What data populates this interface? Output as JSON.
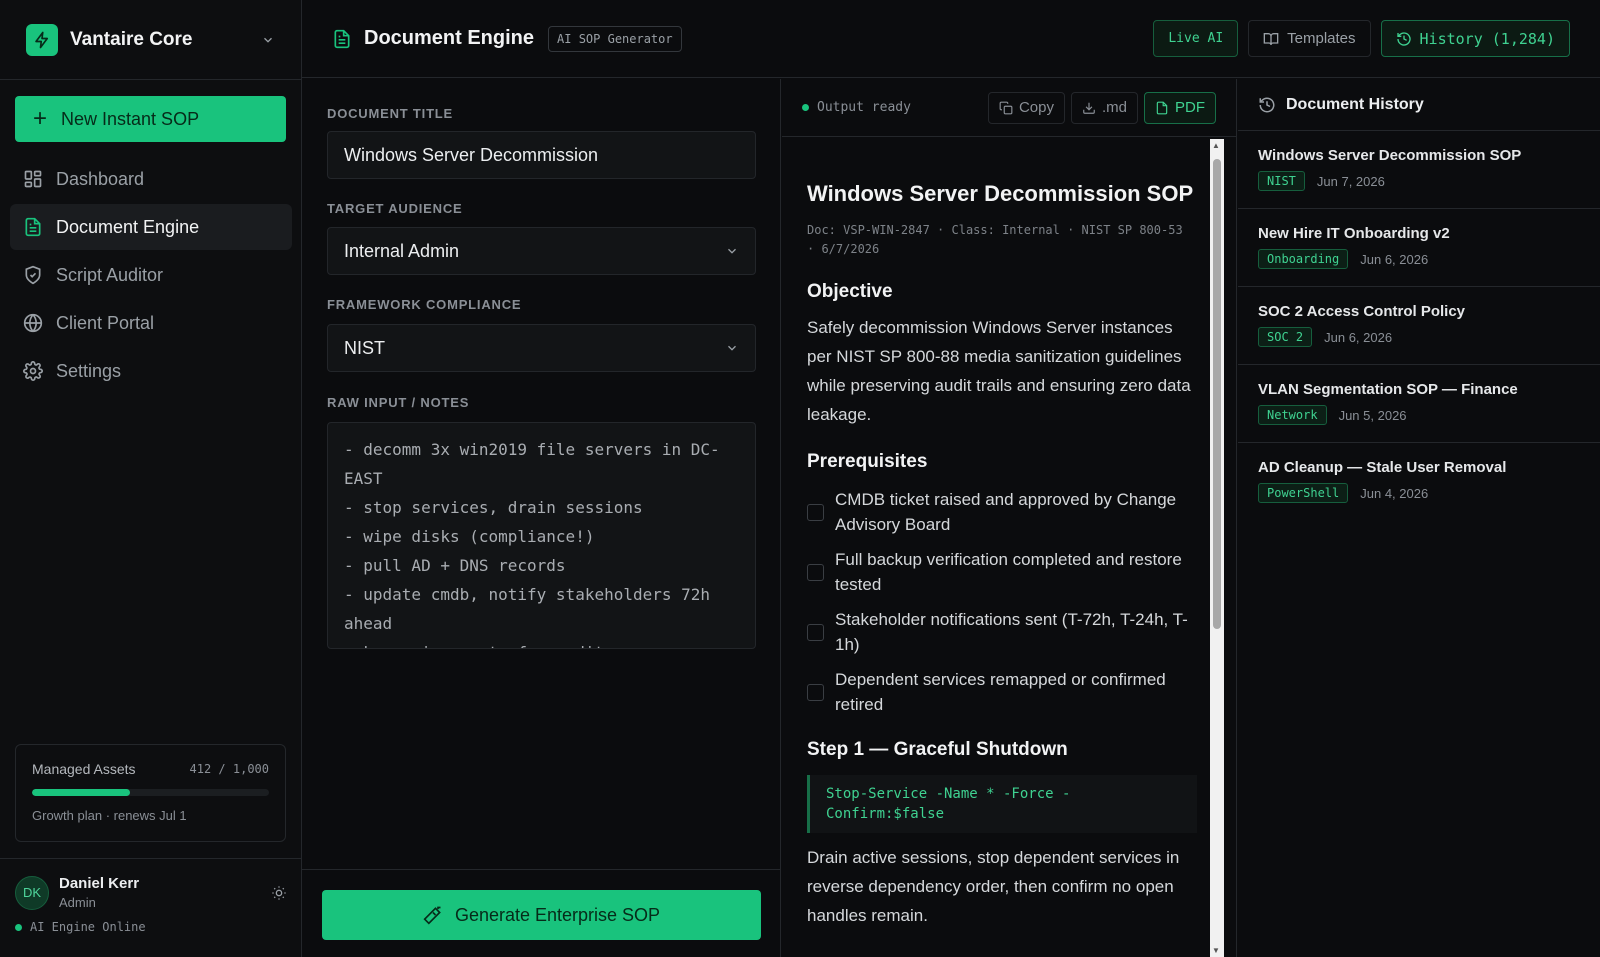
{
  "app": {
    "name": "Vantaire Core"
  },
  "sidebar": {
    "new_button": "New Instant SOP",
    "items": [
      {
        "label": "Dashboard",
        "icon": "dashboard-icon"
      },
      {
        "label": "Document Engine",
        "icon": "document-icon",
        "active": true
      },
      {
        "label": "Script Auditor",
        "icon": "shield-icon"
      },
      {
        "label": "Client Portal",
        "icon": "globe-icon"
      },
      {
        "label": "Settings",
        "icon": "gear-icon"
      }
    ],
    "assets": {
      "label": "Managed Assets",
      "count": "412 / 1,000",
      "progress": 0.412,
      "plan": "Growth plan · renews Jul 1"
    },
    "user": {
      "initials": "DK",
      "name": "Daniel Kerr",
      "role": "Admin",
      "status": "AI Engine Online"
    }
  },
  "header": {
    "title": "Document Engine",
    "tag": "AI SOP Generator",
    "live": "Live AI",
    "templates": "Templates",
    "history": "History (1,284)"
  },
  "form": {
    "title_label": "DOCUMENT TITLE",
    "title_value": "Windows Server Decommission",
    "audience_label": "TARGET AUDIENCE",
    "audience_value": "Internal Admin",
    "framework_label": "FRAMEWORK COMPLIANCE",
    "framework_value": "NIST",
    "notes_label": "RAW INPUT / NOTES",
    "notes_value": "- decomm 3x win2019 file servers in DC-EAST\n- stop services, drain sessions\n- wipe disks (compliance!)\n- pull AD + DNS records\n- update cmdb, notify stakeholders 72h ahead\n- keep wipe certs for audit",
    "generate": "Generate Enterprise SOP"
  },
  "output": {
    "status": "Output ready",
    "copy": "Copy",
    "md": ".md",
    "pdf": "PDF",
    "doc": {
      "title": "Windows Server Decommission SOP",
      "meta": "Doc: VSP-WIN-2847 · Class: Internal · NIST SP 800-53 · 6/7/2026",
      "objective_h": "Objective",
      "objective_p": "Safely decommission Windows Server instances per NIST SP 800-88 media sanitization guidelines while preserving audit trails and ensuring zero data leakage.",
      "prereq_h": "Prerequisites",
      "prereqs": [
        "CMDB ticket raised and approved by Change Advisory Board",
        "Full backup verification completed and restore tested",
        "Stakeholder notifications sent (T-72h, T-24h, T-1h)",
        "Dependent services remapped or confirmed retired"
      ],
      "step1_h": "Step 1 — Graceful Shutdown",
      "step1_code": "Stop-Service -Name * -Force -Confirm:$false",
      "step1_p": "Drain active sessions, stop dependent services in reverse dependency order, then confirm no open handles remain."
    }
  },
  "history": {
    "title": "Document History",
    "items": [
      {
        "title": "Windows Server Decommission SOP",
        "tag": "NIST",
        "date": "Jun 7, 2026"
      },
      {
        "title": "New Hire IT Onboarding v2",
        "tag": "Onboarding",
        "date": "Jun 6, 2026"
      },
      {
        "title": "SOC 2 Access Control Policy",
        "tag": "SOC 2",
        "date": "Jun 6, 2026"
      },
      {
        "title": "VLAN Segmentation SOP — Finance",
        "tag": "Network",
        "date": "Jun 5, 2026"
      },
      {
        "title": "AD Cleanup — Stale User Removal",
        "tag": "PowerShell",
        "date": "Jun 4, 2026"
      }
    ]
  },
  "colors": {
    "accent": "#19c37d",
    "background": "#0b0c0e"
  }
}
